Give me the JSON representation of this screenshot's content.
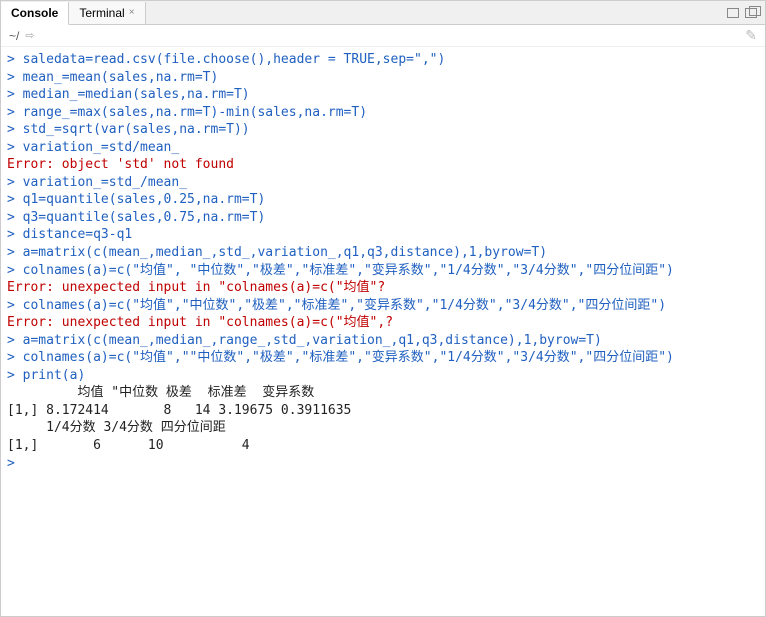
{
  "tabs": {
    "console": "Console",
    "terminal": "Terminal"
  },
  "toolbar": {
    "cwd": "~/"
  },
  "lines": [
    {
      "cls": "in",
      "prompt": "> ",
      "text": "saledata=read.csv(file.choose(),header = TRUE,sep=\",\")"
    },
    {
      "cls": "in",
      "prompt": "> ",
      "text": "mean_=mean(sales,na.rm=T)"
    },
    {
      "cls": "in",
      "prompt": "> ",
      "text": "median_=median(sales,na.rm=T)"
    },
    {
      "cls": "in",
      "prompt": "> ",
      "text": "range_=max(sales,na.rm=T)-min(sales,na.rm=T)"
    },
    {
      "cls": "in",
      "prompt": "> ",
      "text": "std_=sqrt(var(sales,na.rm=T))"
    },
    {
      "cls": "in",
      "prompt": "> ",
      "text": "variation_=std/mean_"
    },
    {
      "cls": "err",
      "prompt": "",
      "text": "Error: object 'std' not found"
    },
    {
      "cls": "in",
      "prompt": "> ",
      "text": "variation_=std_/mean_"
    },
    {
      "cls": "in",
      "prompt": "> ",
      "text": "q1=quantile(sales,0.25,na.rm=T)"
    },
    {
      "cls": "in",
      "prompt": "> ",
      "text": "q3=quantile(sales,0.75,na.rm=T)"
    },
    {
      "cls": "in",
      "prompt": "> ",
      "text": "distance=q3-q1"
    },
    {
      "cls": "in",
      "prompt": "> ",
      "text": "a=matrix(c(mean_,median_,std_,variation_,q1,q3,distance),1,byrow=T)"
    },
    {
      "cls": "in",
      "prompt": "> ",
      "text": "colnames(a)=c(\"均值\", \"中位数\",\"极差\",\"标准差\",\"变异系数\",\"1/4分数\",\"3/4分数\",\"四分位间距\")"
    },
    {
      "cls": "err",
      "prompt": "",
      "text": "Error: unexpected input in \"colnames(a)=c(\"均值\"?"
    },
    {
      "cls": "in",
      "prompt": "> ",
      "text": "colnames(a)=c(\"均值\",\"中位数\",\"极差\",\"标准差\",\"变异系数\",\"1/4分数\",\"3/4分数\",\"四分位间距\")"
    },
    {
      "cls": "err",
      "prompt": "",
      "text": "Error: unexpected input in \"colnames(a)=c(\"均值\",?"
    },
    {
      "cls": "in",
      "prompt": "> ",
      "text": "a=matrix(c(mean_,median_,range_,std_,variation_,q1,q3,distance),1,byrow=T)"
    },
    {
      "cls": "in",
      "prompt": "> ",
      "text": "colnames(a)=c(\"均值\",\"\"中位数\",\"极差\",\"标准差\",\"变异系数\",\"1/4分数\",\"3/4分数\",\"四分位间距\")"
    },
    {
      "cls": "in",
      "prompt": "> ",
      "text": "print(a)"
    },
    {
      "cls": "out",
      "prompt": "",
      "text": "         均值 \"中位数 极差  标准差  变异系数"
    },
    {
      "cls": "out",
      "prompt": "",
      "text": "[1,] 8.172414       8   14 3.19675 0.3911635"
    },
    {
      "cls": "out",
      "prompt": "",
      "text": "     1/4分数 3/4分数 四分位间距"
    },
    {
      "cls": "out",
      "prompt": "",
      "text": "[1,]       6      10          4"
    },
    {
      "cls": "in",
      "prompt": "> ",
      "text": ""
    }
  ]
}
